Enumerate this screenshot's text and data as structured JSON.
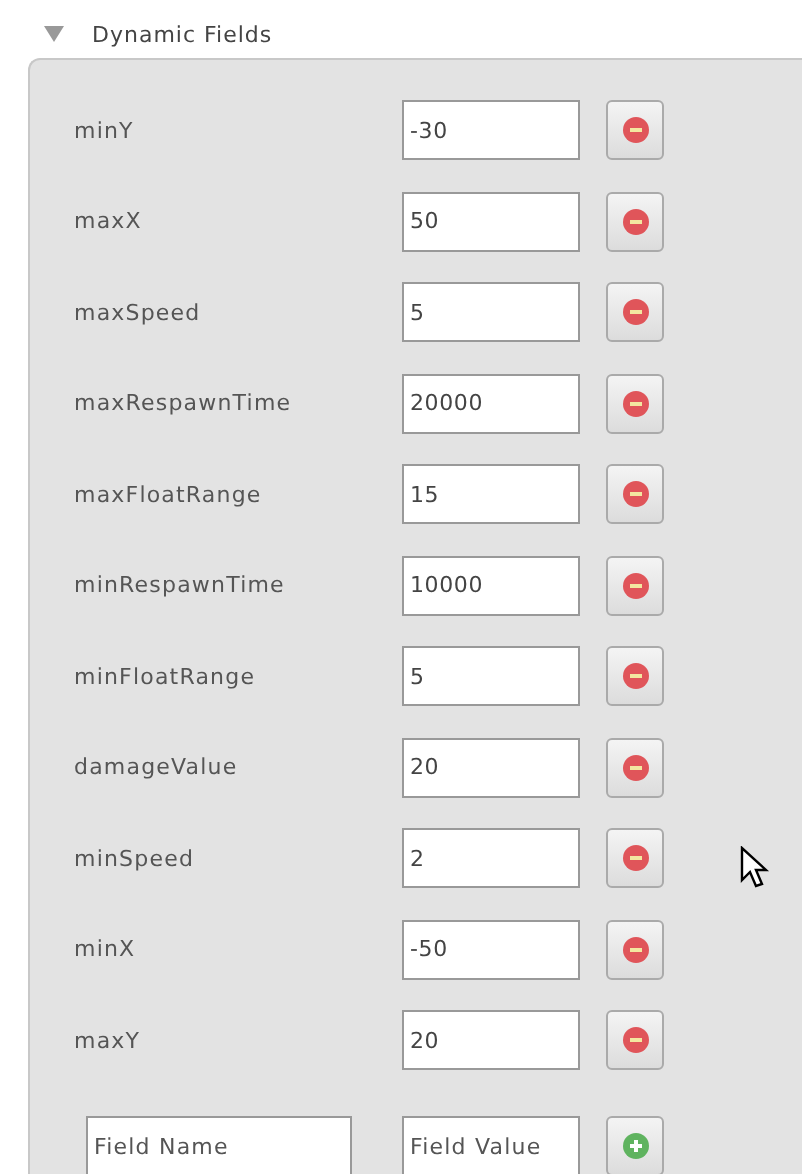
{
  "section": {
    "title": "Dynamic Fields",
    "expanded": true
  },
  "fields": [
    {
      "name": "minY",
      "value": "-30"
    },
    {
      "name": "maxX",
      "value": "50"
    },
    {
      "name": "maxSpeed",
      "value": "5"
    },
    {
      "name": "maxRespawnTime",
      "value": "20000"
    },
    {
      "name": "maxFloatRange",
      "value": "15"
    },
    {
      "name": "minRespawnTime",
      "value": "10000"
    },
    {
      "name": "minFloatRange",
      "value": "5"
    },
    {
      "name": "damageValue",
      "value": "20"
    },
    {
      "name": "minSpeed",
      "value": "2"
    },
    {
      "name": "minX",
      "value": "-50"
    },
    {
      "name": "maxY",
      "value": "20"
    }
  ],
  "new_field": {
    "name_placeholder": "Field Name",
    "value_placeholder": "Field Value"
  }
}
